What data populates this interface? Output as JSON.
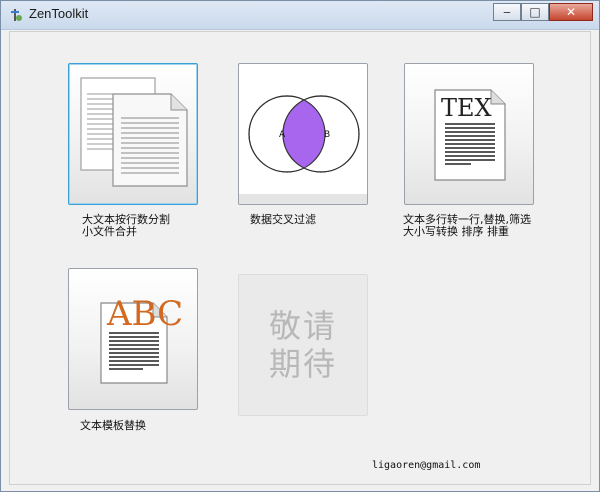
{
  "window": {
    "title": "ZenToolkit",
    "minimize": "‒",
    "maximize": "□",
    "close": "✕"
  },
  "tiles": [
    {
      "label": "大文本按行数分割\n小文件合并",
      "icon": "documents-icon",
      "selected": true
    },
    {
      "label": "数据交叉过滤",
      "icon": "venn-diagram-icon",
      "venn_left": "A",
      "venn_right": "B"
    },
    {
      "label": "文本多行转一行,替换,筛选\n大小写转换 排序 排重",
      "icon": "tex-document-icon",
      "tex_text": "TEX"
    },
    {
      "label": "文本模板替换",
      "icon": "abc-document-icon",
      "abc_text": "ABC"
    },
    {
      "coming_soon_line1": "敬请",
      "coming_soon_line2": "期待"
    }
  ],
  "footer": {
    "email": "ligaoren@gmail.com"
  },
  "colors": {
    "venn_intersection": "#a866ee",
    "abc_letter": "#d2691e",
    "selected_border": "#3aa0d6"
  }
}
